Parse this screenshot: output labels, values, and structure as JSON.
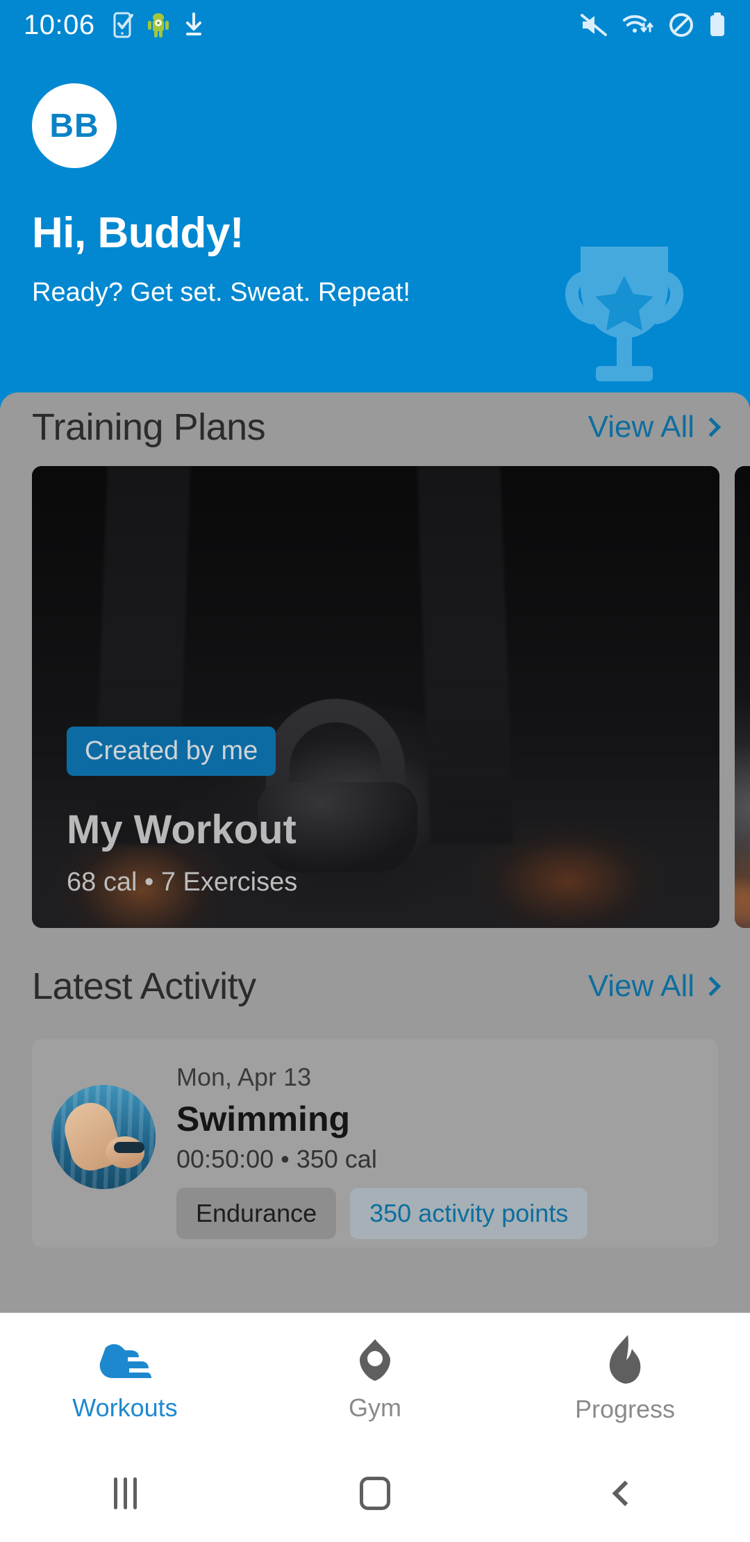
{
  "status_bar": {
    "time": "10:06",
    "left_icons": [
      "task-check-icon",
      "android-robot-icon",
      "download-icon"
    ],
    "right_icons": [
      "mute-icon",
      "wifi-icon",
      "do-not-disturb-icon",
      "battery-icon"
    ]
  },
  "header": {
    "avatar_initials": "BB",
    "greeting": "Hi, Buddy!",
    "subtitle": "Ready? Get set. Sweat. Repeat!",
    "decor_icon": "trophy-icon",
    "background_color": "#0288d1"
  },
  "training_plans": {
    "title": "Training Plans",
    "view_all_label": "View All",
    "cards": [
      {
        "badge": "Created by me",
        "title": "My Workout",
        "meta": "68 cal • 7 Exercises",
        "calories": 68,
        "exercises": 7
      }
    ]
  },
  "latest_activity": {
    "title": "Latest Activity",
    "view_all_label": "View All",
    "items": [
      {
        "date": "Mon, Apr 13",
        "name": "Swimming",
        "stats": "00:50:00 • 350 cal",
        "duration": "00:50:00",
        "calories": "350 cal",
        "tags": [
          "Endurance",
          "350 activity points"
        ]
      }
    ]
  },
  "bottom_nav": {
    "items": [
      {
        "label": "Workouts",
        "icon": "running-shoe-icon",
        "active": true
      },
      {
        "label": "Gym",
        "icon": "location-pin-icon",
        "active": false
      },
      {
        "label": "Progress",
        "icon": "flame-icon",
        "active": false
      }
    ],
    "active_color": "#1e88cf",
    "idle_color": "#8a8a8a"
  },
  "android_nav": {
    "recents_label": "Recent apps",
    "home_label": "Home",
    "back_label": "Back"
  },
  "theme": {
    "primary": "#0288d1",
    "link": "#0d6e9e",
    "scrim": "#9a9a9a"
  }
}
